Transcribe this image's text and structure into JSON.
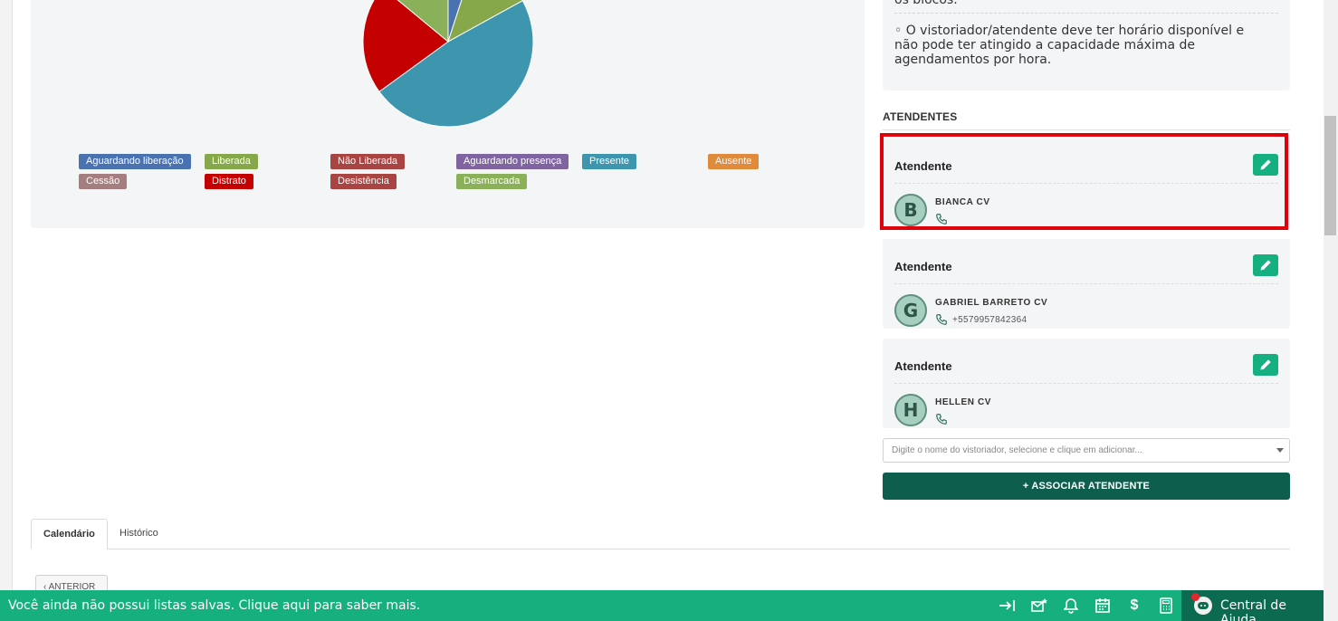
{
  "chart": {
    "type": "pie",
    "slices": [
      {
        "status": "Aguardando liberação",
        "color": "#4a72b0",
        "value": 5
      },
      {
        "status": "Liberada",
        "color": "#87a84a",
        "value": 12
      },
      {
        "status": "Presente",
        "color": "#3d95ae",
        "value": 48
      },
      {
        "status": "Distrato",
        "color": "#c40000",
        "value": 21
      },
      {
        "status": "Desmarcada",
        "color": "#8bb05a",
        "value": 14
      }
    ]
  },
  "legend": {
    "items": [
      {
        "label": "Aguardando liberação",
        "color": "#4a72b0"
      },
      {
        "label": "Liberada",
        "color": "#87a84a"
      },
      {
        "label": "Não Liberada",
        "color": "#a94442"
      },
      {
        "label": "Aguardando presença",
        "color": "#8064a2"
      },
      {
        "label": "Presente",
        "color": "#3d95ae"
      },
      {
        "label": "Ausente",
        "color": "#e08a3c"
      },
      {
        "label": "Cessão",
        "color": "#a57f7f"
      },
      {
        "label": "Distrato",
        "color": "#c40000"
      },
      {
        "label": "Desistência",
        "color": "#a94442"
      },
      {
        "label": "Desmarcada",
        "color": "#8bb05a"
      }
    ]
  },
  "rules": {
    "top_fragment": "os blocos.",
    "rule_text": "◦ O vistoriador/atendente deve ter horário disponível e não pode ter atingido a capacidade máxima de agendamentos por hora."
  },
  "attendants_section": {
    "title": "ATENDENTES",
    "cards": [
      {
        "title": "Atendente",
        "initial": "B",
        "name": "BIANCA CV",
        "phone": ""
      },
      {
        "title": "Atendente",
        "initial": "G",
        "name": "GABRIEL BARRETO CV",
        "phone": "+5579957842364"
      },
      {
        "title": "Atendente",
        "initial": "H",
        "name": "HELLEN CV",
        "phone": ""
      }
    ],
    "select_placeholder": "Digite o nome do vistoriador, selecione e clique em adicionar...",
    "associate_button": "+ ASSOCIAR ATENDENTE"
  },
  "tabs": {
    "items": [
      {
        "label": "Calendário",
        "active": true
      },
      {
        "label": "Histórico",
        "active": false
      }
    ]
  },
  "prev_button": "ANTERIOR",
  "bottom_bar": {
    "message": "Você ainda não possui listas salvas. Clique aqui para saber mais.",
    "icons": [
      "collapse-right-icon",
      "mail-star-icon",
      "bell-icon",
      "calendar-icon",
      "dollar-icon",
      "calculator-icon"
    ],
    "help_label": "Central de Ajuda"
  },
  "colors": {
    "accent_green": "#15b07e",
    "dark_green": "#0d5e4c",
    "highlight_red": "#e0000c"
  }
}
